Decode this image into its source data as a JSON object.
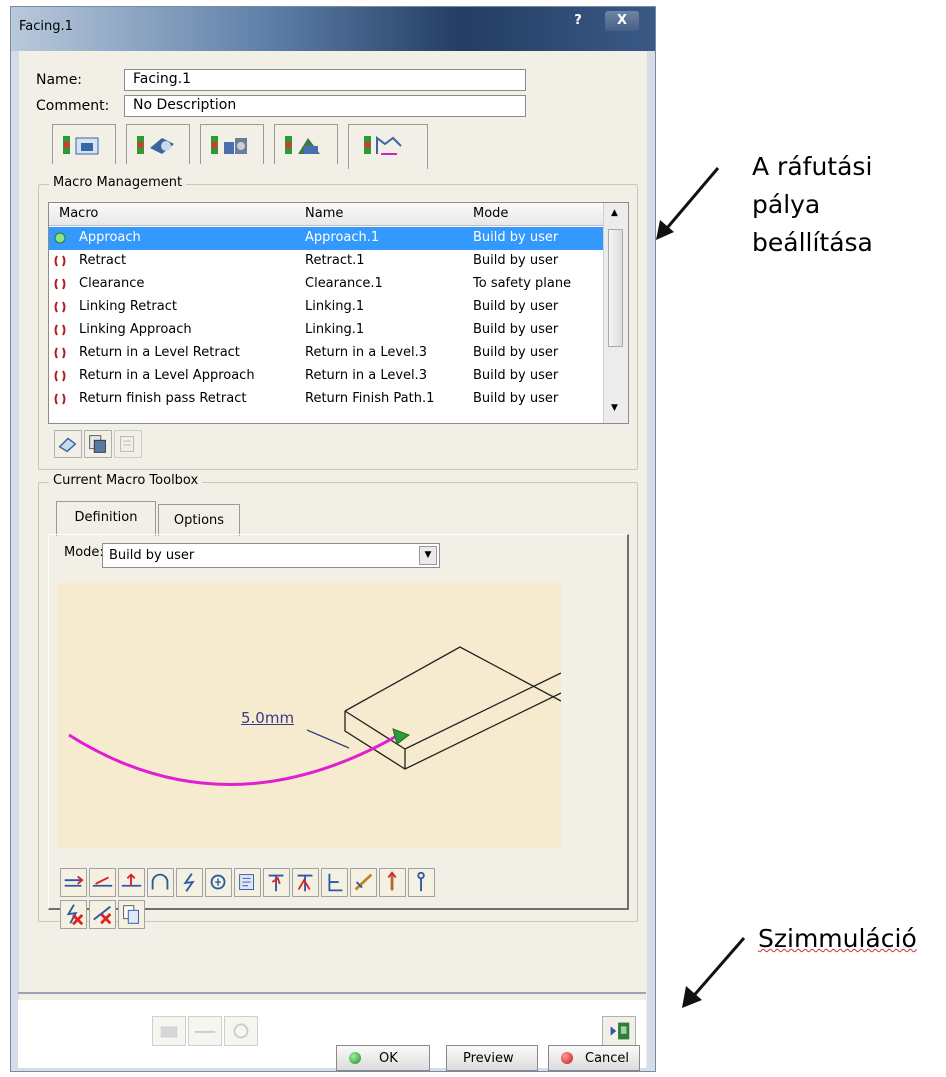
{
  "window": {
    "title": "Facing.1",
    "help_label": "?",
    "close_label": "X"
  },
  "form": {
    "name_label": "Name:",
    "name_value": "Facing.1",
    "comment_label": "Comment:",
    "comment_value": "No Description"
  },
  "tabs": [
    {
      "icon": "geometry-tab-icon"
    },
    {
      "icon": "strategy-tab-icon"
    },
    {
      "icon": "tool-tab-icon"
    },
    {
      "icon": "feeds-speeds-tab-icon"
    },
    {
      "icon": "macros-tab-icon",
      "active": true
    }
  ],
  "macro_management": {
    "group_title": "Macro Management",
    "columns": [
      "Macro",
      "Name",
      "Mode"
    ],
    "rows": [
      {
        "macro": "Approach",
        "name": "Approach.1",
        "mode": "Build by user",
        "selected": true
      },
      {
        "macro": "Retract",
        "name": "Retract.1",
        "mode": "Build by user"
      },
      {
        "macro": "Clearance",
        "name": "Clearance.1",
        "mode": "To safety plane"
      },
      {
        "macro": "Linking Retract",
        "name": "Linking.1",
        "mode": "Build by user"
      },
      {
        "macro": "Linking Approach",
        "name": "Linking.1",
        "mode": "Build by user"
      },
      {
        "macro": "Return in a Level Retract",
        "name": "Return in a Level.3",
        "mode": "Build by user"
      },
      {
        "macro": "Return in a Level Approach",
        "name": "Return in a Level.3",
        "mode": "Build by user"
      },
      {
        "macro": "Return finish pass Retract",
        "name": "Return Finish Path.1",
        "mode": "Build by user"
      }
    ]
  },
  "toolbox": {
    "group_title": "Current Macro Toolbox",
    "tabs": [
      "Definition",
      "Options"
    ],
    "mode_label": "Mode:",
    "mode_value": "Build by user",
    "dimension_label": "5.0mm"
  },
  "buttons": {
    "ok": "OK",
    "preview": "Preview",
    "cancel": "Cancel"
  },
  "annotations": {
    "top_line1": "A ráfutási",
    "top_line2": "pálya",
    "top_line3": "beállítása",
    "bottom": "Szimmuláció"
  },
  "colors": {
    "selection": "#3399ff",
    "path": "#e020d0",
    "panel": "#f1efe6",
    "canvas": "#f7ebcf"
  }
}
